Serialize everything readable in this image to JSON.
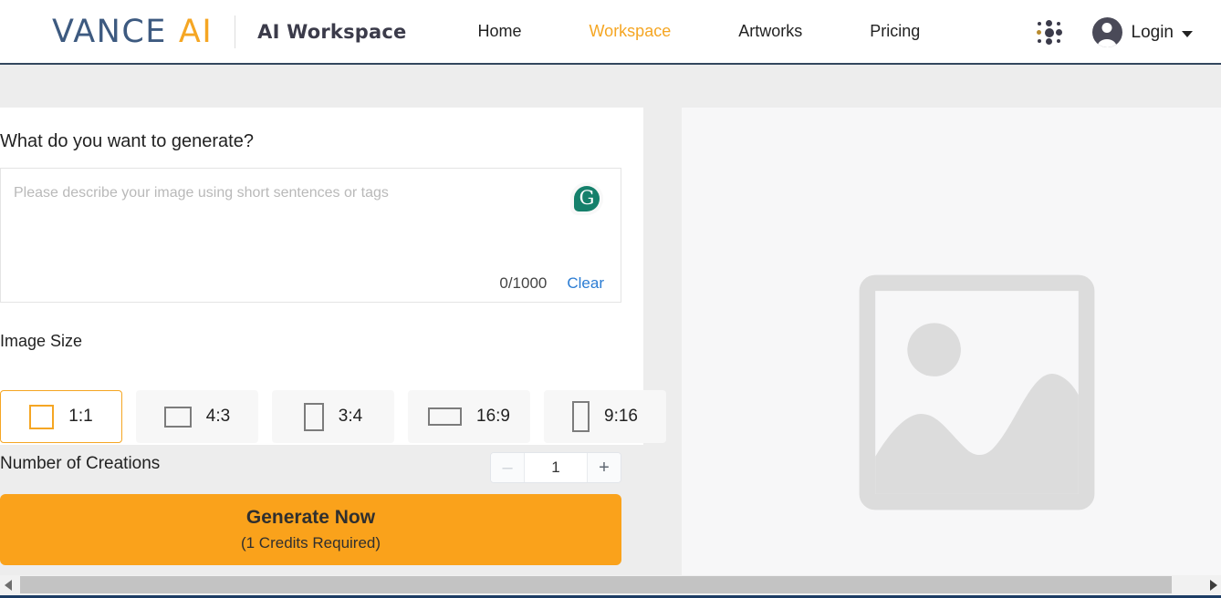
{
  "header": {
    "logo": {
      "primary": "VANCE",
      "accent": "AI",
      "icon": "vance-ai-logo"
    },
    "app_title": "AI Workspace",
    "nav": [
      {
        "label": "Home",
        "active": false
      },
      {
        "label": "Workspace",
        "active": true
      },
      {
        "label": "Artworks",
        "active": false
      },
      {
        "label": "Pricing",
        "active": false
      }
    ],
    "apps_icon": "grid-dots-icon",
    "account": {
      "avatar_icon": "user-avatar-icon",
      "label": "Login",
      "caret_icon": "chevron-down-icon"
    },
    "accent_color": "#f5a623",
    "logo_color": "#3d5a80",
    "border_color": "#33475e"
  },
  "left_panel": {
    "heading": "What do you want to generate?",
    "prompt": {
      "value": "",
      "placeholder": "Please describe your image using short sentences or tags",
      "char_count": "0/1000",
      "clear_label": "Clear",
      "grammarly_icon": "grammarly-icon",
      "grammarly_letter": "G"
    },
    "image_size": {
      "label": "Image Size",
      "options": [
        {
          "label": "1:1",
          "shape": "square",
          "selected": true
        },
        {
          "label": "4:3",
          "shape": "landscape-4-3",
          "selected": false
        },
        {
          "label": "3:4",
          "shape": "portrait-3-4",
          "selected": false
        },
        {
          "label": "16:9",
          "shape": "landscape-16-9",
          "selected": false
        },
        {
          "label": "9:16",
          "shape": "portrait-9-16",
          "selected": false
        }
      ]
    },
    "creations": {
      "label": "Number of Creations",
      "value": "1",
      "minus_label": "–",
      "plus_label": "+"
    },
    "generate": {
      "main_label": "Generate Now",
      "sub_label": "(1 Credits Required)",
      "color": "#faa21b"
    }
  },
  "right_panel": {
    "placeholder_icon": "image-placeholder-icon",
    "background": "#f7f7f8"
  },
  "scrollbar": {
    "left_arrow_icon": "scroll-left-arrow-icon",
    "right_arrow_icon": "scroll-right-arrow-icon",
    "orientation": "horizontal"
  }
}
